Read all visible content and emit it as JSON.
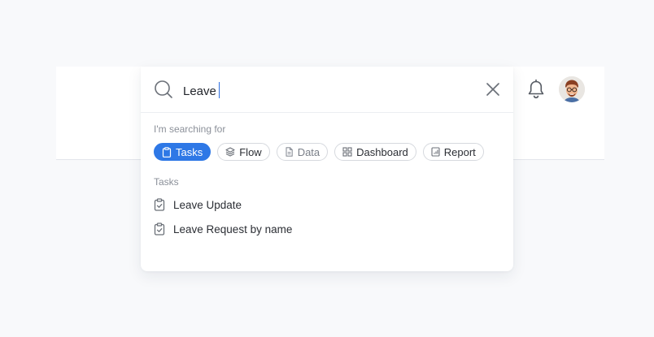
{
  "search": {
    "query": "Leave"
  },
  "filters": {
    "label": "I'm searching for",
    "chips": [
      {
        "label": "Tasks",
        "icon": "clipboard-icon",
        "active": true
      },
      {
        "label": "Flow",
        "icon": "layers-icon",
        "active": false
      },
      {
        "label": "Data",
        "icon": "document-icon",
        "active": false
      },
      {
        "label": "Dashboard",
        "icon": "grid-icon",
        "active": false
      },
      {
        "label": "Report",
        "icon": "report-icon",
        "active": false
      }
    ]
  },
  "results": {
    "section_label": "Tasks",
    "items": [
      {
        "label": "Leave Update",
        "icon": "clipboard-check-icon"
      },
      {
        "label": "Leave Request by name",
        "icon": "clipboard-check-icon"
      }
    ]
  },
  "colors": {
    "accent": "#2e78e6",
    "background": "#f8f9fb"
  }
}
